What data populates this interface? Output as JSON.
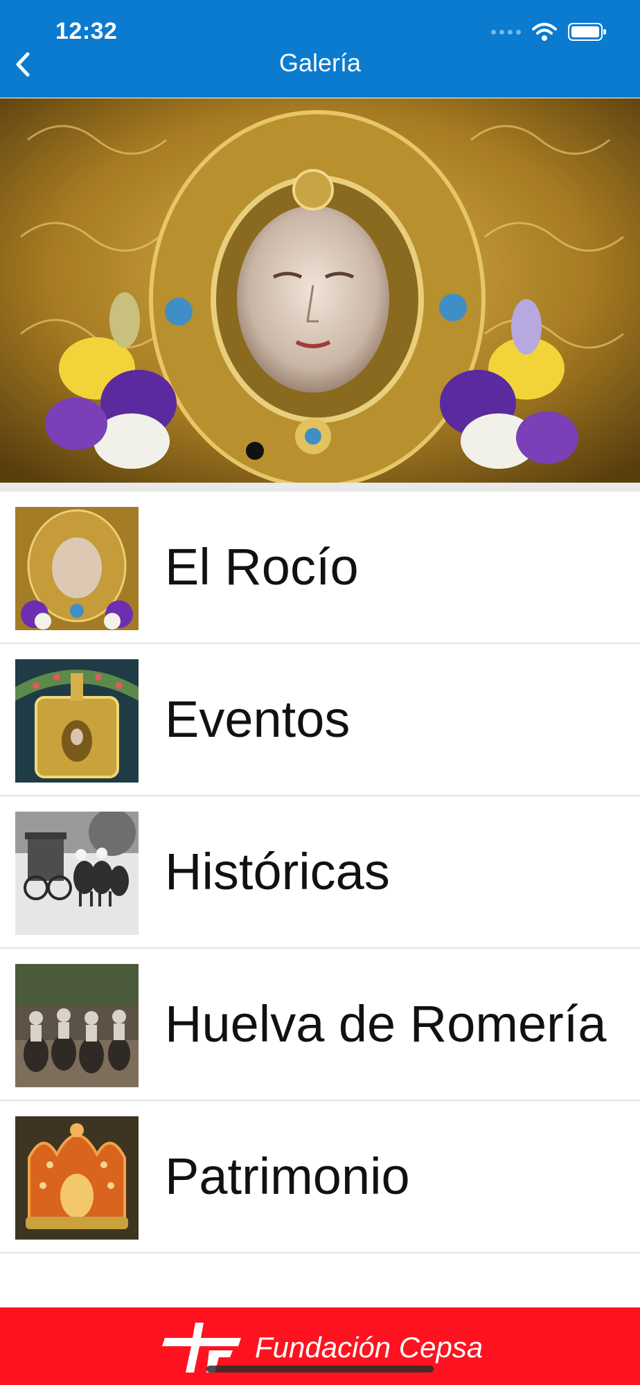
{
  "status_bar": {
    "time": "12:32"
  },
  "nav": {
    "title": "Galería"
  },
  "gallery_list": [
    {
      "label": "El Rocío",
      "thumb_icon": "virgin-face-image"
    },
    {
      "label": "Eventos",
      "thumb_icon": "silver-float-image"
    },
    {
      "label": "Históricas",
      "thumb_icon": "historic-carriage-image"
    },
    {
      "label": "Huelva de Romería",
      "thumb_icon": "pilgrims-horses-image"
    },
    {
      "label": "Patrimonio",
      "thumb_icon": "golden-crown-image"
    }
  ],
  "footer": {
    "brand": "Fundación Cepsa"
  },
  "colors": {
    "nav_bar": "#0a7bcf",
    "footer": "#ff1220",
    "text": "#111111"
  }
}
